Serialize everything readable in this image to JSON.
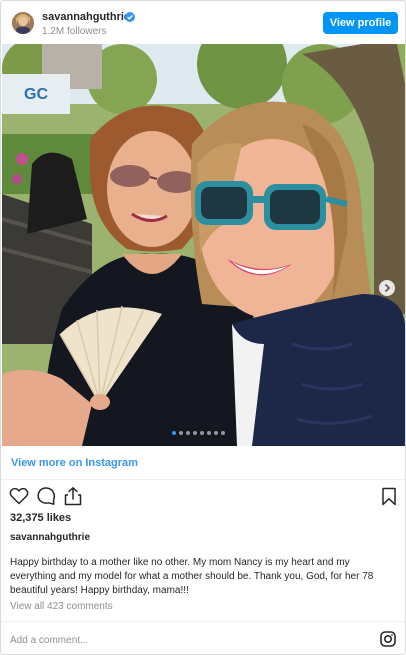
{
  "header": {
    "username": "savannahguthrie",
    "verified": true,
    "followers": "1.2M followers",
    "view_profile_label": "View profile"
  },
  "photo": {
    "sign_text": "GC",
    "carousel": {
      "total": 8,
      "active": 1
    }
  },
  "view_more_label": "View more on Instagram",
  "actions": {
    "like": "heart-icon",
    "comment": "comment-icon",
    "share": "share-icon",
    "save": "bookmark-icon"
  },
  "likes": "32,375 likes",
  "owner_username": "savannahguthrie",
  "caption": "Happy birthday to a mother like no other. My mom Nancy is my heart and my everything and my model for what a mother should be. Thank you, God, for her 78 beautiful years! Happy birthday, mama!!!",
  "view_comments_label": "View all 423 comments",
  "comment_placeholder": "Add a comment...",
  "colors": {
    "accent": "#0095f6",
    "link": "#3897f0",
    "muted": "#8e8e8e",
    "text": "#262626"
  }
}
